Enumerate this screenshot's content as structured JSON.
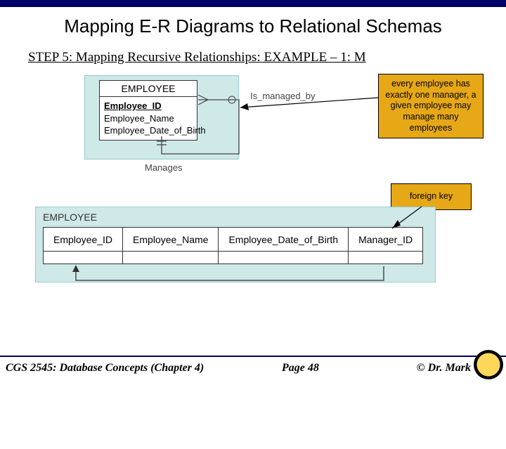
{
  "title": "Mapping E-R Diagrams to Relational Schemas",
  "step": "STEP 5:  Mapping Recursive Relationships: EXAMPLE – 1: M",
  "er": {
    "entity": "EMPLOYEE",
    "attrs": [
      "Employee_ID",
      "Employee_Name",
      "Employee_Date_of_Birth"
    ],
    "rel_right": "Is_managed_by",
    "rel_bottom": "Manages"
  },
  "callouts": {
    "c1": "every employee has exactly one manager, a given employee may manage many employees",
    "c2": "foreign key"
  },
  "relational": {
    "name": "EMPLOYEE",
    "cols": [
      "Employee_ID",
      "Employee_Name",
      "Employee_Date_of_Birth",
      "Manager_ID"
    ]
  },
  "footer": {
    "left": "CGS 2545: Database Concepts  (Chapter 4)",
    "center": "Page 48",
    "right": "©  Dr. Mark"
  }
}
